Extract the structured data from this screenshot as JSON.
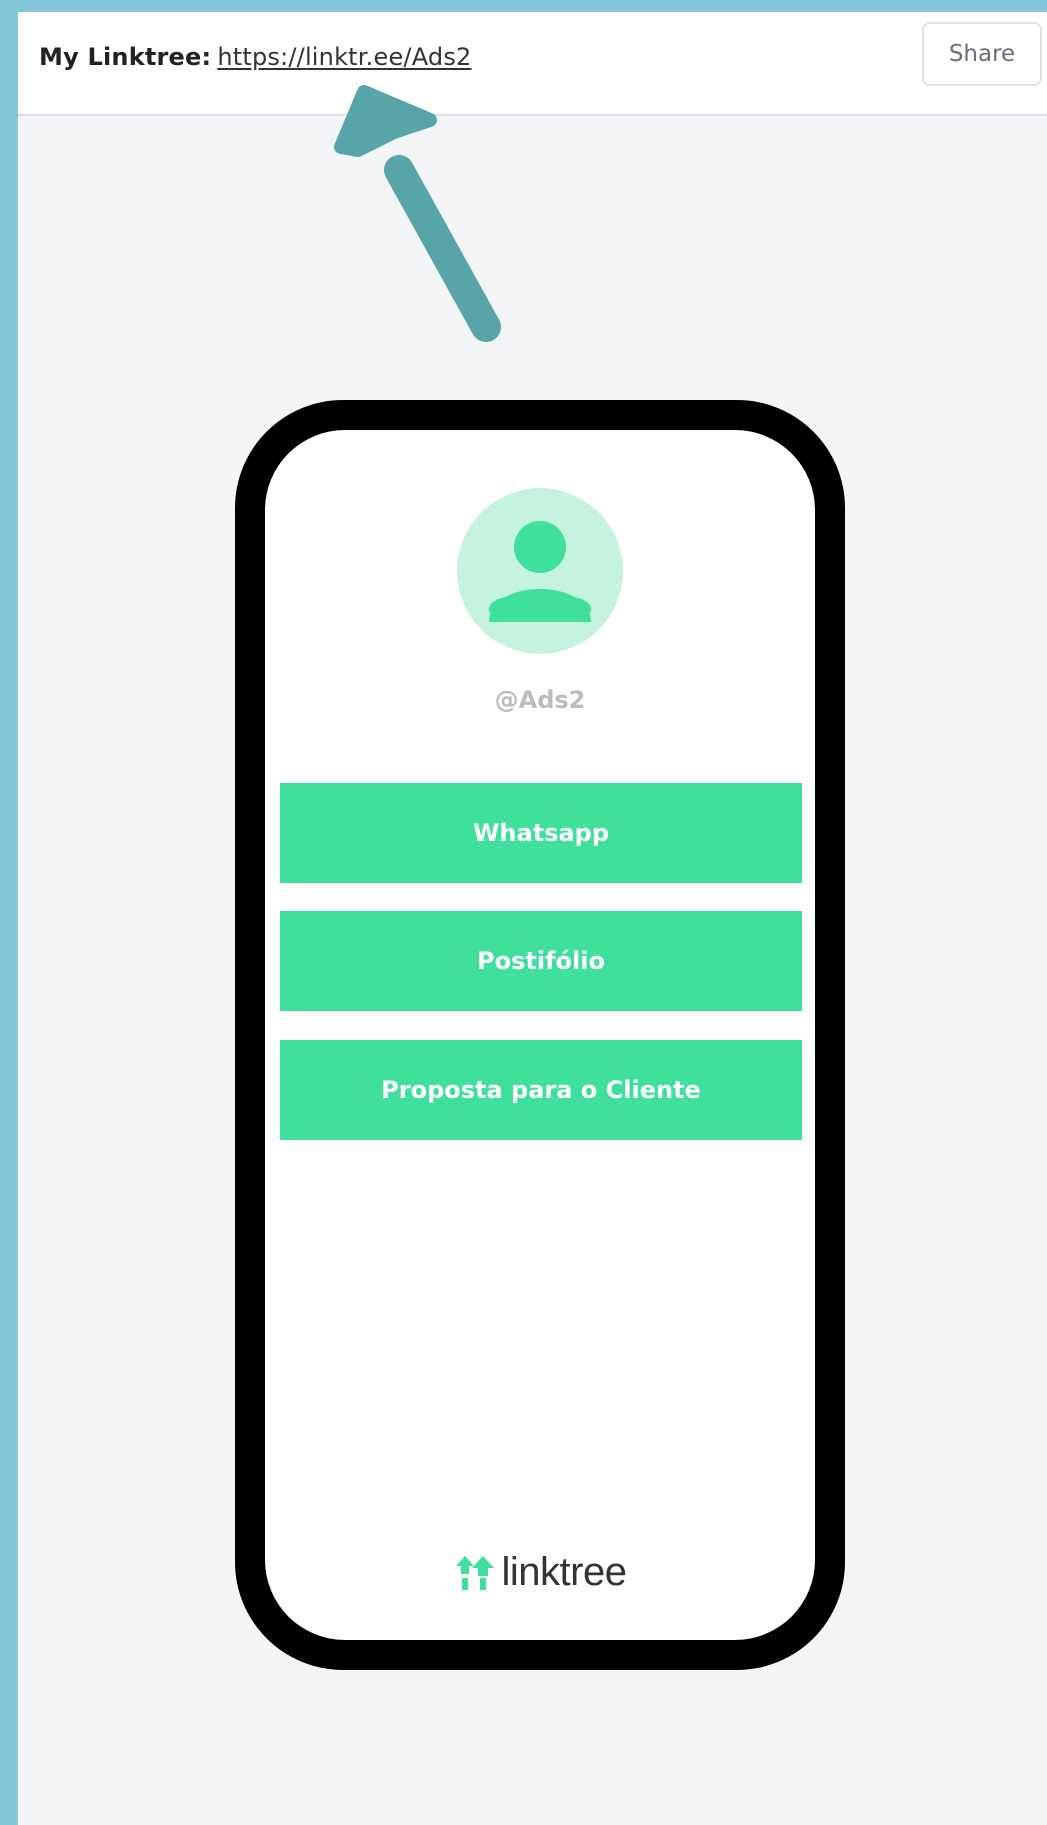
{
  "header": {
    "label": "My Linktree:",
    "url": "https://linktr.ee/Ads2",
    "share_label": "Share"
  },
  "profile": {
    "handle": "@Ads2"
  },
  "links": [
    {
      "label": "Whatsapp"
    },
    {
      "label": "Postifólio"
    },
    {
      "label": "Proposta para o Cliente"
    }
  ],
  "brand": {
    "name": "linktree"
  },
  "icons": {
    "arrow": "up-left-arrow-icon",
    "avatar": "user-avatar-icon",
    "logo": "linktree-logo-icon"
  },
  "colors": {
    "frame": "#85c6d9",
    "accent": "#3ee09c",
    "avatar_bg": "#c5f3df",
    "arrow": "#57a5a8"
  }
}
